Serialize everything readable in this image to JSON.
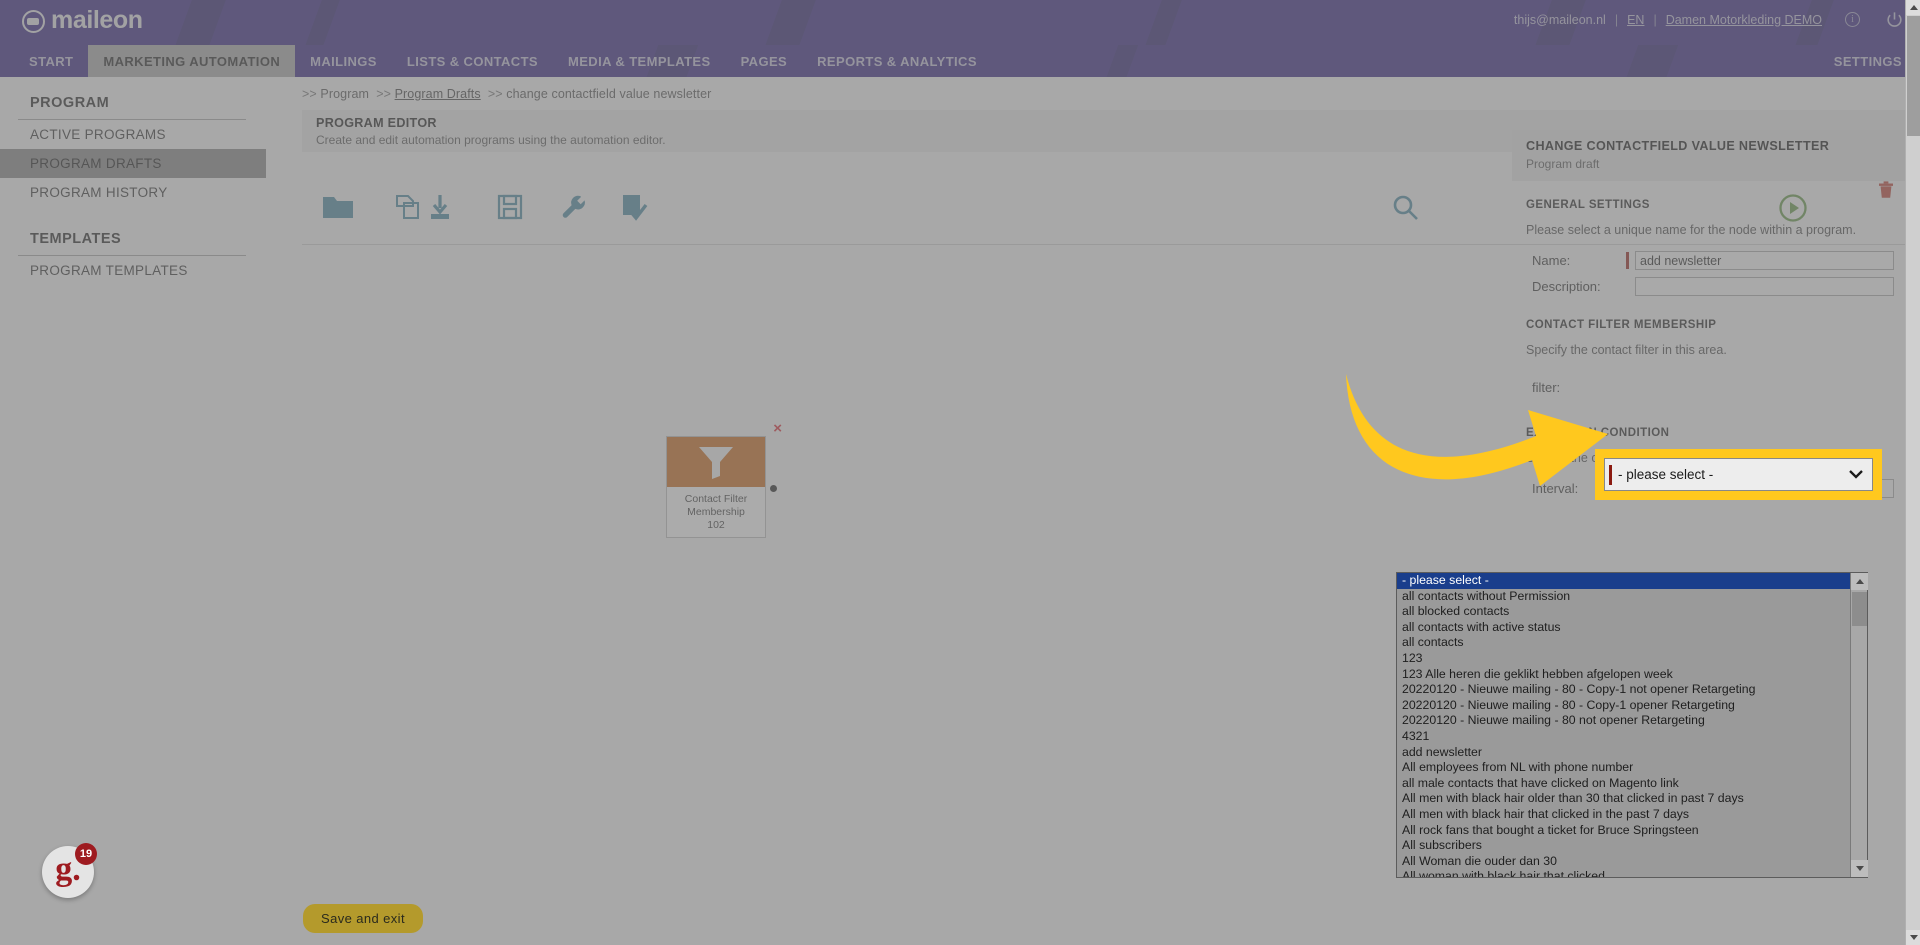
{
  "header": {
    "brand": "maileon",
    "user_email": "thijs@maileon.nl",
    "sep": "|",
    "language": "EN",
    "account": "Damen Motorkleding DEMO",
    "info_icon": "i",
    "icons": {
      "info": "info-icon",
      "power": "power-icon"
    }
  },
  "nav": {
    "items": [
      {
        "label": "START",
        "active": false
      },
      {
        "label": "MARKETING AUTOMATION",
        "active": true
      },
      {
        "label": "MAILINGS",
        "active": false
      },
      {
        "label": "LISTS & CONTACTS",
        "active": false
      },
      {
        "label": "MEDIA & TEMPLATES",
        "active": false
      },
      {
        "label": "PAGES",
        "active": false
      },
      {
        "label": "REPORTS & ANALYTICS",
        "active": false
      }
    ],
    "settings_label": "SETTINGS"
  },
  "sidebar": {
    "group1_title": "PROGRAM",
    "group1_items": [
      {
        "label": "ACTIVE PROGRAMS",
        "active": false
      },
      {
        "label": "PROGRAM DRAFTS",
        "active": true
      },
      {
        "label": "PROGRAM HISTORY",
        "active": false
      }
    ],
    "group2_title": "TEMPLATES",
    "group2_items": [
      {
        "label": "PROGRAM TEMPLATES",
        "active": false
      }
    ]
  },
  "breadcrumb": {
    "a1": ">>",
    "item1": "Program",
    "a2": ">>",
    "item2": "Program Drafts",
    "a3": ">>",
    "item3": "change contactfield value newsletter"
  },
  "editor_panel": {
    "title": "PROGRAM EDITOR",
    "subtitle": "Create and edit automation programs using the automation editor."
  },
  "toolbar": {
    "icons": [
      {
        "name": "open-folder-icon",
        "title": "Open"
      },
      {
        "name": "copy-icon",
        "title": "Copy"
      },
      {
        "name": "import-download-icon",
        "title": "Import"
      },
      {
        "name": "save-floppy-icon",
        "title": "Save"
      },
      {
        "name": "wrench-icon",
        "title": "Settings"
      },
      {
        "name": "validate-checklist-icon",
        "title": "Validate"
      },
      {
        "name": "search-icon",
        "title": "Search"
      },
      {
        "name": "play-start-icon",
        "title": "Start program"
      }
    ]
  },
  "canvas": {
    "node": {
      "label_line1": "Contact Filter",
      "label_line2": "Membership",
      "label_line3": "102",
      "icon": "funnel-icon",
      "close": "×",
      "color": "#c06010"
    }
  },
  "right_panel": {
    "title": "CHANGE CONTACTFIELD VALUE NEWSLETTER",
    "subtitle": "Program draft",
    "delete_icon": "trash-icon",
    "general": {
      "section_title": "GENERAL SETTINGS",
      "description": "Please select a unique name for the node within a program.",
      "name_label": "Name:",
      "name_value": "add newsletter",
      "description_label": "Description:",
      "description_value": ""
    },
    "membership": {
      "section_title": "CONTACT FILTER MEMBERSHIP",
      "description": "Specify the contact filter in this area.",
      "filter_label": "filter:",
      "filter_value": "- please select -"
    },
    "execution": {
      "section_title": "EXECUTION CONDITION",
      "description": "Specify the contact filter related settings in this area.",
      "interval_label": "Interval:",
      "interval_value": "- please select -"
    }
  },
  "dropdown": {
    "selected": "- please select -",
    "options": [
      "- please select -",
      "all contacts without Permission",
      "all blocked contacts",
      "all contacts with active status",
      "all contacts",
      "123",
      "123 Alle heren die geklikt hebben afgelopen week",
      "20220120 - Nieuwe mailing - 80 - Copy-1 not opener Retargeting",
      "20220120 - Nieuwe mailing - 80 - Copy-1 opener Retargeting",
      "20220120 - Nieuwe mailing - 80 not opener Retargeting",
      "4321",
      "add newsletter",
      "All employees from NL with phone number",
      "all male contacts that have clicked on Magento link",
      "All men with black hair older than 30 that clicked in past 7 days",
      "All men with black hair that clicked in the past 7 days",
      "All rock fans that bought a ticket for Bruce Springsteen",
      "All subscribers",
      "All Woman die ouder dan 30",
      "All woman with black hair that clicked"
    ]
  },
  "footer": {
    "save_exit_label": "Save and exit",
    "chat_letter": "g.",
    "chat_count": "19"
  },
  "colors": {
    "brand_purple": "#2b1a78",
    "highlight_yellow": "#FFC81E",
    "node_orange": "#c06010",
    "toolbar_blue": "#3f7f96",
    "play_green": "#5a8f3d",
    "save_button": "#b49a2c"
  }
}
